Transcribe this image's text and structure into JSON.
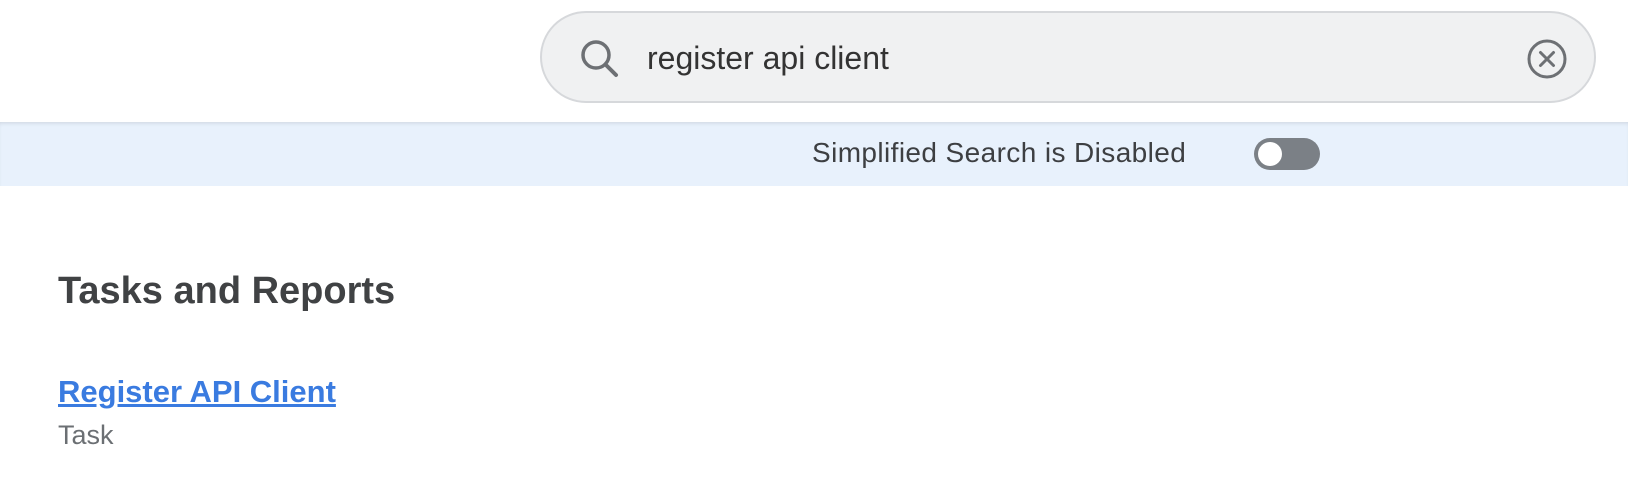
{
  "search": {
    "value": "register api client",
    "icon": "search-icon",
    "clear_icon": "clear-circle-icon"
  },
  "banner": {
    "text": "Simplified Search is Disabled",
    "toggle_on": false
  },
  "results": {
    "section_title": "Tasks and Reports",
    "items": [
      {
        "title": "Register API Client",
        "type": "Task"
      }
    ]
  },
  "colors": {
    "link": "#3a7be0",
    "banner_bg": "#e8f1fc",
    "toggle_off": "#7b8086"
  }
}
